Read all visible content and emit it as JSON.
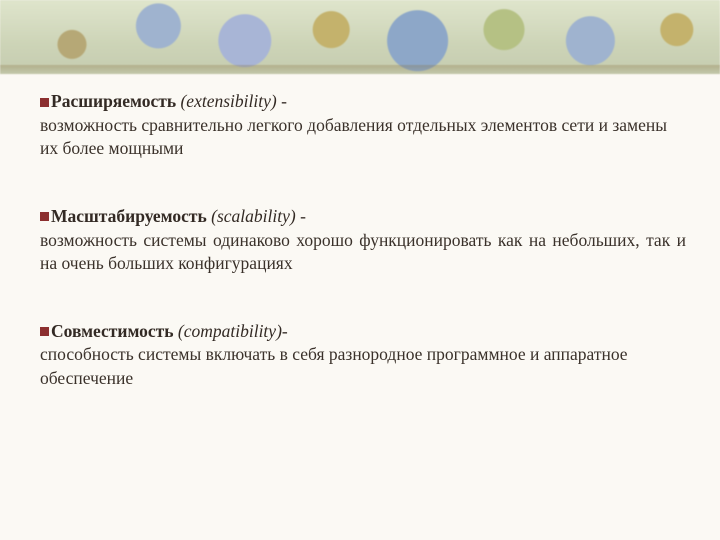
{
  "items": [
    {
      "term": "Расширяемость",
      "english": "(extensibility)",
      "dash": " - ",
      "desc": "возможность сравнительно легкого добавления отдельных элементов сети и замены их более мощными",
      "justify": false
    },
    {
      "term": "Масштабируемость",
      "english": "(scalability)",
      "dash": " - ",
      "desc": "возможность системы одинаково хорошо функционировать как на небольших, так и на очень больших конфигурациях",
      "justify": true
    },
    {
      "term": "Совместимость",
      "english": "(compatibility)",
      "dash": "- ",
      "desc": "способность системы включать в себя разнородное программное и аппаратное обеспечение",
      "justify": false
    }
  ]
}
